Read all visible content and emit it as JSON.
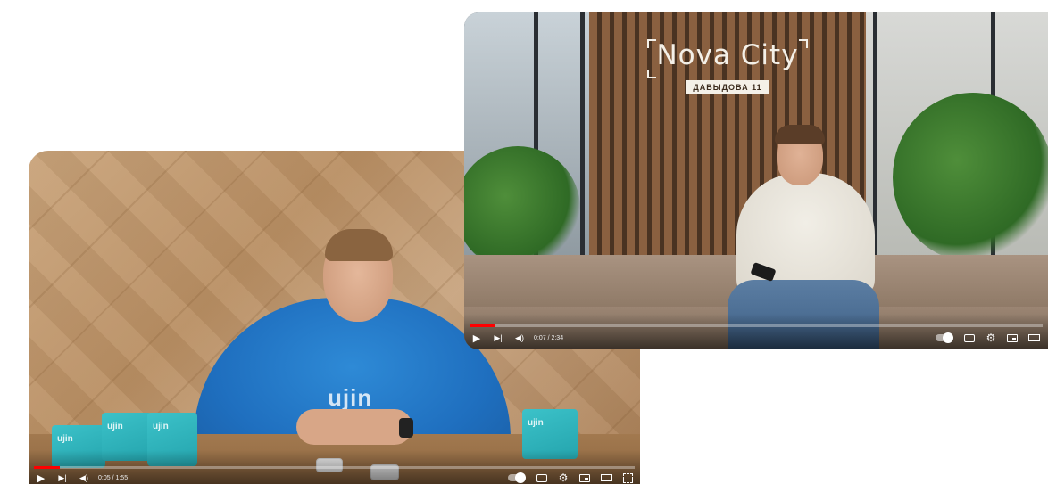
{
  "players": [
    {
      "id": "left",
      "scene_text": {
        "hoodie_logo": "ujin",
        "box_labels": [
          "ujin",
          "ujin",
          "ujin",
          "ujin"
        ]
      },
      "time_display": "0:05 / 1:55",
      "progress_fraction": 0.043,
      "controls": {
        "play_icon": "▶",
        "next_icon": "▶|",
        "volume_icon": "◀)",
        "settings_icon": "⚙"
      }
    },
    {
      "id": "right",
      "scene_text": {
        "sign_title": "Nova City",
        "sign_subtitle": "ДАВЫДОВА 11"
      },
      "time_display": "0:07 / 2:34",
      "progress_fraction": 0.045,
      "controls": {
        "play_icon": "▶",
        "next_icon": "▶|",
        "volume_icon": "◀)",
        "settings_icon": "⚙"
      }
    }
  ],
  "colors": {
    "progress_played": "#ff0000",
    "hoodie": "#1f6fbf",
    "box_teal": "#2fb5bd"
  }
}
